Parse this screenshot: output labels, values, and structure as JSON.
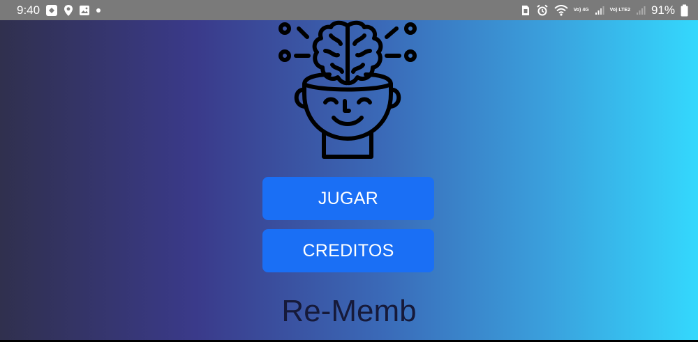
{
  "status_bar": {
    "time": "9:40",
    "battery_percent": "91%",
    "network_label_1": "Vo) 4G",
    "network_label_2": "Vo) LTE2",
    "icons_left": [
      "app-notification-icon",
      "location-icon",
      "gallery-icon",
      "dot-icon"
    ],
    "icons_right": [
      "sim-icon",
      "alarm-icon",
      "wifi-icon",
      "signal-icon",
      "signal-icon-2",
      "battery-icon"
    ]
  },
  "app": {
    "logo_icon": "brain-head-icon",
    "play_button_label": "JUGAR",
    "credits_button_label": "CREDITOS",
    "title": "Re-Memb"
  },
  "colors": {
    "gradient_start": "#30304e",
    "gradient_mid": "#3a3a8a",
    "gradient_end": "#34d8fd",
    "button": "#1a6ff5",
    "title_text": "#161a3a",
    "status_bar": "#7a7a7a"
  }
}
